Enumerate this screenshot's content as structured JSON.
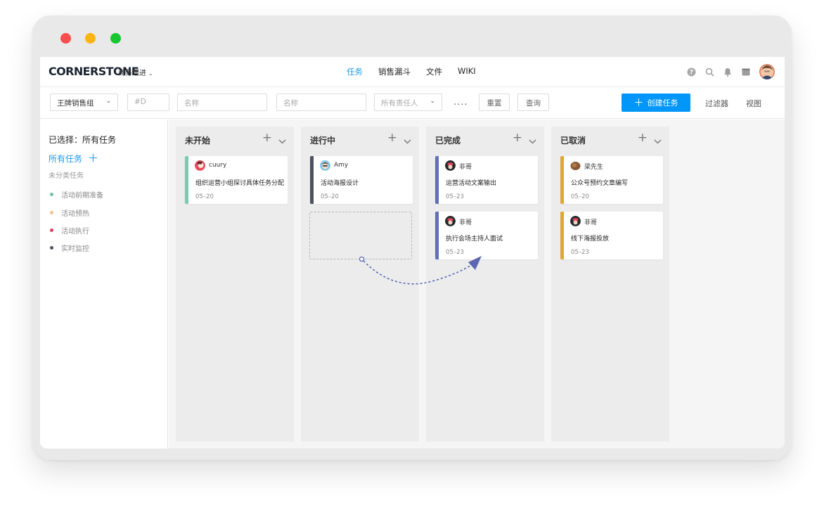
{
  "window": {
    "controls": [
      "close",
      "minimize",
      "maximize"
    ]
  },
  "nav": {
    "logo": "CORNERSTONE",
    "project": "商务跟进",
    "tabs": [
      {
        "label": "任务",
        "active": true
      },
      {
        "label": "销售漏斗",
        "active": false
      },
      {
        "label": "文件",
        "active": false
      },
      {
        "label": "WIKI",
        "active": false
      }
    ],
    "icons": [
      "help-icon",
      "search-icon",
      "bell-icon",
      "calendar-icon"
    ]
  },
  "filters": {
    "group": "王牌销售组",
    "id_placeholder": "#D",
    "name1_placeholder": "名称",
    "name2_placeholder": "名称",
    "owner_placeholder": "所有责任人",
    "more": "....",
    "reset": "重置",
    "query": "查询",
    "create": "创建任务",
    "filter": "过滤器",
    "view": "视图"
  },
  "sidebar": {
    "selected": "已选择：所有任务",
    "all": "所有任务",
    "uncategorized": "未分类任务",
    "categories": [
      {
        "label": "活动前期准备",
        "color": "#6fc3a4"
      },
      {
        "label": "活动预热",
        "color": "#f5c18a"
      },
      {
        "label": "活动执行",
        "color": "#e0405c"
      },
      {
        "label": "实时监控",
        "color": "#4e5260"
      }
    ]
  },
  "columns": [
    {
      "title": "未开始",
      "cards": [
        {
          "name": "cuury",
          "title": "组织运营小组探讨具体任务分配",
          "date": "05–20",
          "color": "#7ccbb0"
        }
      ]
    },
    {
      "title": "进行中",
      "cards": [
        {
          "name": "Amy",
          "title": "活动海报设计",
          "date": "05–20",
          "color": "#4d5262"
        }
      ]
    },
    {
      "title": "已完成",
      "cards": [
        {
          "name": "非哥",
          "title": "运营活动文案输出",
          "date": "05–23",
          "color": "#6370b6"
        },
        {
          "name": "非哥",
          "title": "执行会场主持人面试",
          "date": "05–23",
          "color": "#6370b6"
        }
      ]
    },
    {
      "title": "已取消",
      "cards": [
        {
          "name": "梁先生",
          "title": "公众号预约文章编写",
          "date": "05–20",
          "color": "#e0a83a"
        },
        {
          "name": "非哥",
          "title": "线下海报投放",
          "date": "05–23",
          "color": "#e0a83a"
        }
      ]
    }
  ],
  "colors": {
    "accent": "#0096fa",
    "link": "#1a9bf0"
  }
}
